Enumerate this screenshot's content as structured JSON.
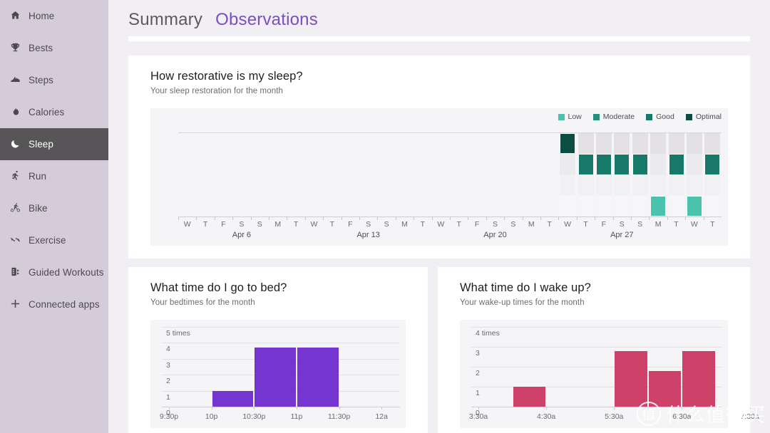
{
  "sidebar": {
    "items": [
      {
        "label": "Home",
        "icon": "home-icon",
        "glyph": "⌂",
        "selected": false
      },
      {
        "label": "Bests",
        "icon": "trophy-icon",
        "glyph": "Ἴ6",
        "selected": false
      },
      {
        "label": "Steps",
        "icon": "shoe-icon",
        "glyph": "◢",
        "selected": false
      },
      {
        "label": "Calories",
        "icon": "flame-icon",
        "glyph": "◕",
        "selected": false
      },
      {
        "label": "Sleep",
        "icon": "moon-icon",
        "glyph": "☾",
        "selected": true
      },
      {
        "label": "Run",
        "icon": "runner-icon",
        "glyph": "Ἴ3",
        "selected": false
      },
      {
        "label": "Bike",
        "icon": "bicycle-icon",
        "glyph": "Ὣ2",
        "selected": false
      },
      {
        "label": "Exercise",
        "icon": "dumbbell-icon",
        "glyph": "⚔",
        "selected": false
      },
      {
        "label": "Guided Workouts",
        "icon": "guided-workouts-icon",
        "glyph": "὏1",
        "selected": false
      },
      {
        "label": "Connected apps",
        "icon": "plus-icon",
        "glyph": "✚",
        "selected": false
      }
    ]
  },
  "tabs": [
    {
      "label": "Summary",
      "active": false
    },
    {
      "label": "Observations",
      "active": true
    }
  ],
  "cards": {
    "restorative": {
      "title": "How restorative is my sleep?",
      "subtitle": "Your sleep restoration for the month"
    },
    "bedtime": {
      "title": "What time do I go to bed?",
      "subtitle": "Your bedtimes for the month"
    },
    "wake": {
      "title": "What time do I wake up?",
      "subtitle": "Your wake-up times for the month"
    }
  },
  "colors": {
    "accent_purple": "#7535D0",
    "accent_crimson": "#CE4269",
    "tab_active": "#7a4fc0",
    "sidebar_bg": "#d4cdd9",
    "sidebar_selected_bg": "#575557",
    "page_bg": "#f1eef4",
    "card_bg": "#ffffff",
    "plot_bg": "#f5f4f6",
    "low": "#4BC3AC",
    "moderate": "#22907C",
    "good": "#16796A",
    "optimal": "#0C4C42"
  },
  "chart_data": [
    {
      "id": "sleep-restoration",
      "type": "bar",
      "title": "How restorative is my sleep?",
      "subtitle": "Your sleep restoration for the month",
      "xlabel": "",
      "ylabel": "",
      "grid": false,
      "legend_position": "top-right",
      "legend": [
        {
          "name": "Low",
          "color": "#4BC3AC",
          "level": 1
        },
        {
          "name": "Moderate",
          "color": "#22907C",
          "level": 2
        },
        {
          "name": "Good",
          "color": "#16796A",
          "level": 3
        },
        {
          "name": "Optimal",
          "color": "#0C4C42",
          "level": 4
        }
      ],
      "week_labels": [
        "Apr 6",
        "Apr 13",
        "Apr 20",
        "Apr 27"
      ],
      "day_labels": [
        "W",
        "T",
        "F",
        "S",
        "S",
        "M",
        "T",
        "W",
        "T",
        "F",
        "S",
        "S",
        "M",
        "T",
        "W",
        "T",
        "F",
        "S",
        "S",
        "M",
        "T",
        "W",
        "T",
        "F",
        "S",
        "S",
        "M",
        "T",
        "W",
        "T"
      ],
      "values": [
        null,
        null,
        null,
        null,
        null,
        null,
        null,
        null,
        null,
        null,
        null,
        null,
        null,
        null,
        null,
        null,
        null,
        null,
        null,
        null,
        null,
        "Optimal",
        "Good",
        "Good",
        "Good",
        "Good",
        "Low",
        "Good",
        "Low",
        "Good"
      ]
    },
    {
      "id": "bedtime-histogram",
      "type": "bar",
      "title": "What time do I go to bed?",
      "subtitle": "Your bedtimes for the month",
      "xlabel": "",
      "ylabel": "times",
      "ylim": [
        0,
        5
      ],
      "yticks": [
        "5 times",
        "4",
        "3",
        "2",
        "1",
        "0"
      ],
      "xticks": [
        "9:30p",
        "10p",
        "10:30p",
        "11p",
        "11:30p",
        "12a"
      ],
      "bar_color": "#7535D0",
      "bins": [
        "9:30p",
        "10p",
        "10:30p",
        "11p",
        "11:30p"
      ],
      "values": [
        0,
        1,
        3.7,
        3.7,
        0
      ]
    },
    {
      "id": "wakeup-histogram",
      "type": "bar",
      "title": "What time do I wake up?",
      "subtitle": "Your wake-up times for the month",
      "xlabel": "",
      "ylabel": "times",
      "ylim": [
        0,
        4
      ],
      "yticks": [
        "4 times",
        "3",
        "2",
        "1",
        "0"
      ],
      "xticks": [
        "3:30a",
        "4:30a",
        "5:30a",
        "6:30a",
        "7:30a"
      ],
      "bar_color": "#CE4269",
      "bins": [
        "3:30a",
        "4:00a",
        "4:30a",
        "5:00a",
        "5:30a",
        "6:00a",
        "6:30a"
      ],
      "values": [
        0,
        1,
        0,
        0,
        2.8,
        1.8,
        2.8
      ]
    }
  ],
  "watermark": {
    "glyph": "值",
    "text": "什么值得买"
  }
}
